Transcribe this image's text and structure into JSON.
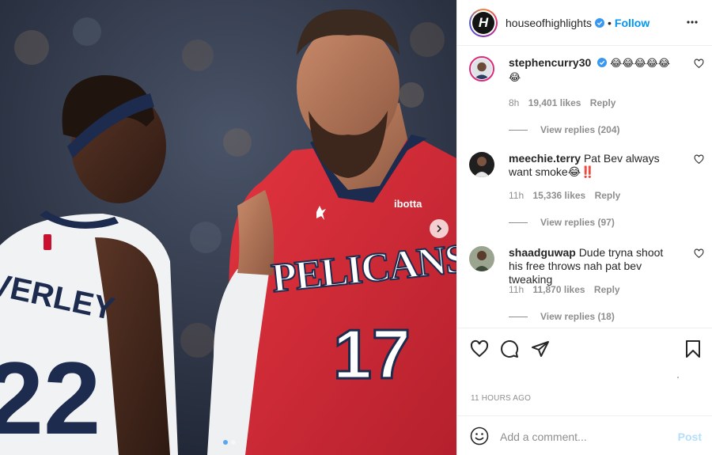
{
  "post": {
    "author": "houseofhighlights",
    "follow_label": "Follow",
    "separator": "•",
    "timestamp": "11 HOURS AGO"
  },
  "comments": [
    {
      "username": "stephencurry30",
      "verified": true,
      "text": "😂😂😂😂😂😂",
      "time": "8h",
      "likes": "19,401 likes",
      "reply_label": "Reply",
      "view_replies": "View replies (204)"
    },
    {
      "username": "meechie.terry",
      "verified": false,
      "text": "Pat Bev always want smoke😂‼️",
      "time": "11h",
      "likes": "15,336 likes",
      "reply_label": "Reply",
      "view_replies": "View replies (97)"
    },
    {
      "username": "shaadguwap",
      "verified": false,
      "text": "Dude tryna shoot his free throws nah pat bev tweaking",
      "time": "11h",
      "likes": "11,870 likes",
      "reply_label": "Reply",
      "view_replies": "View replies (18)"
    }
  ],
  "add_comment": {
    "placeholder": "Add a comment...",
    "post_label": "Post"
  },
  "media": {
    "jersey_left_name": "EVERLEY",
    "jersey_left_number": "22",
    "jersey_right_team": "PELICANS",
    "jersey_right_number": "17",
    "jersey_right_sponsor": "ibotta",
    "carousel_total": 2,
    "carousel_index": 1
  },
  "colors": {
    "accent": "#0095f6",
    "pelicans_red": "#d3293a",
    "wolves_navy": "#1c2b4e"
  },
  "icons": [
    "verified-badge-icon",
    "more-options-icon",
    "heart-icon",
    "comment-icon",
    "share-icon",
    "save-icon",
    "emoji-icon",
    "chevron-right-icon"
  ]
}
